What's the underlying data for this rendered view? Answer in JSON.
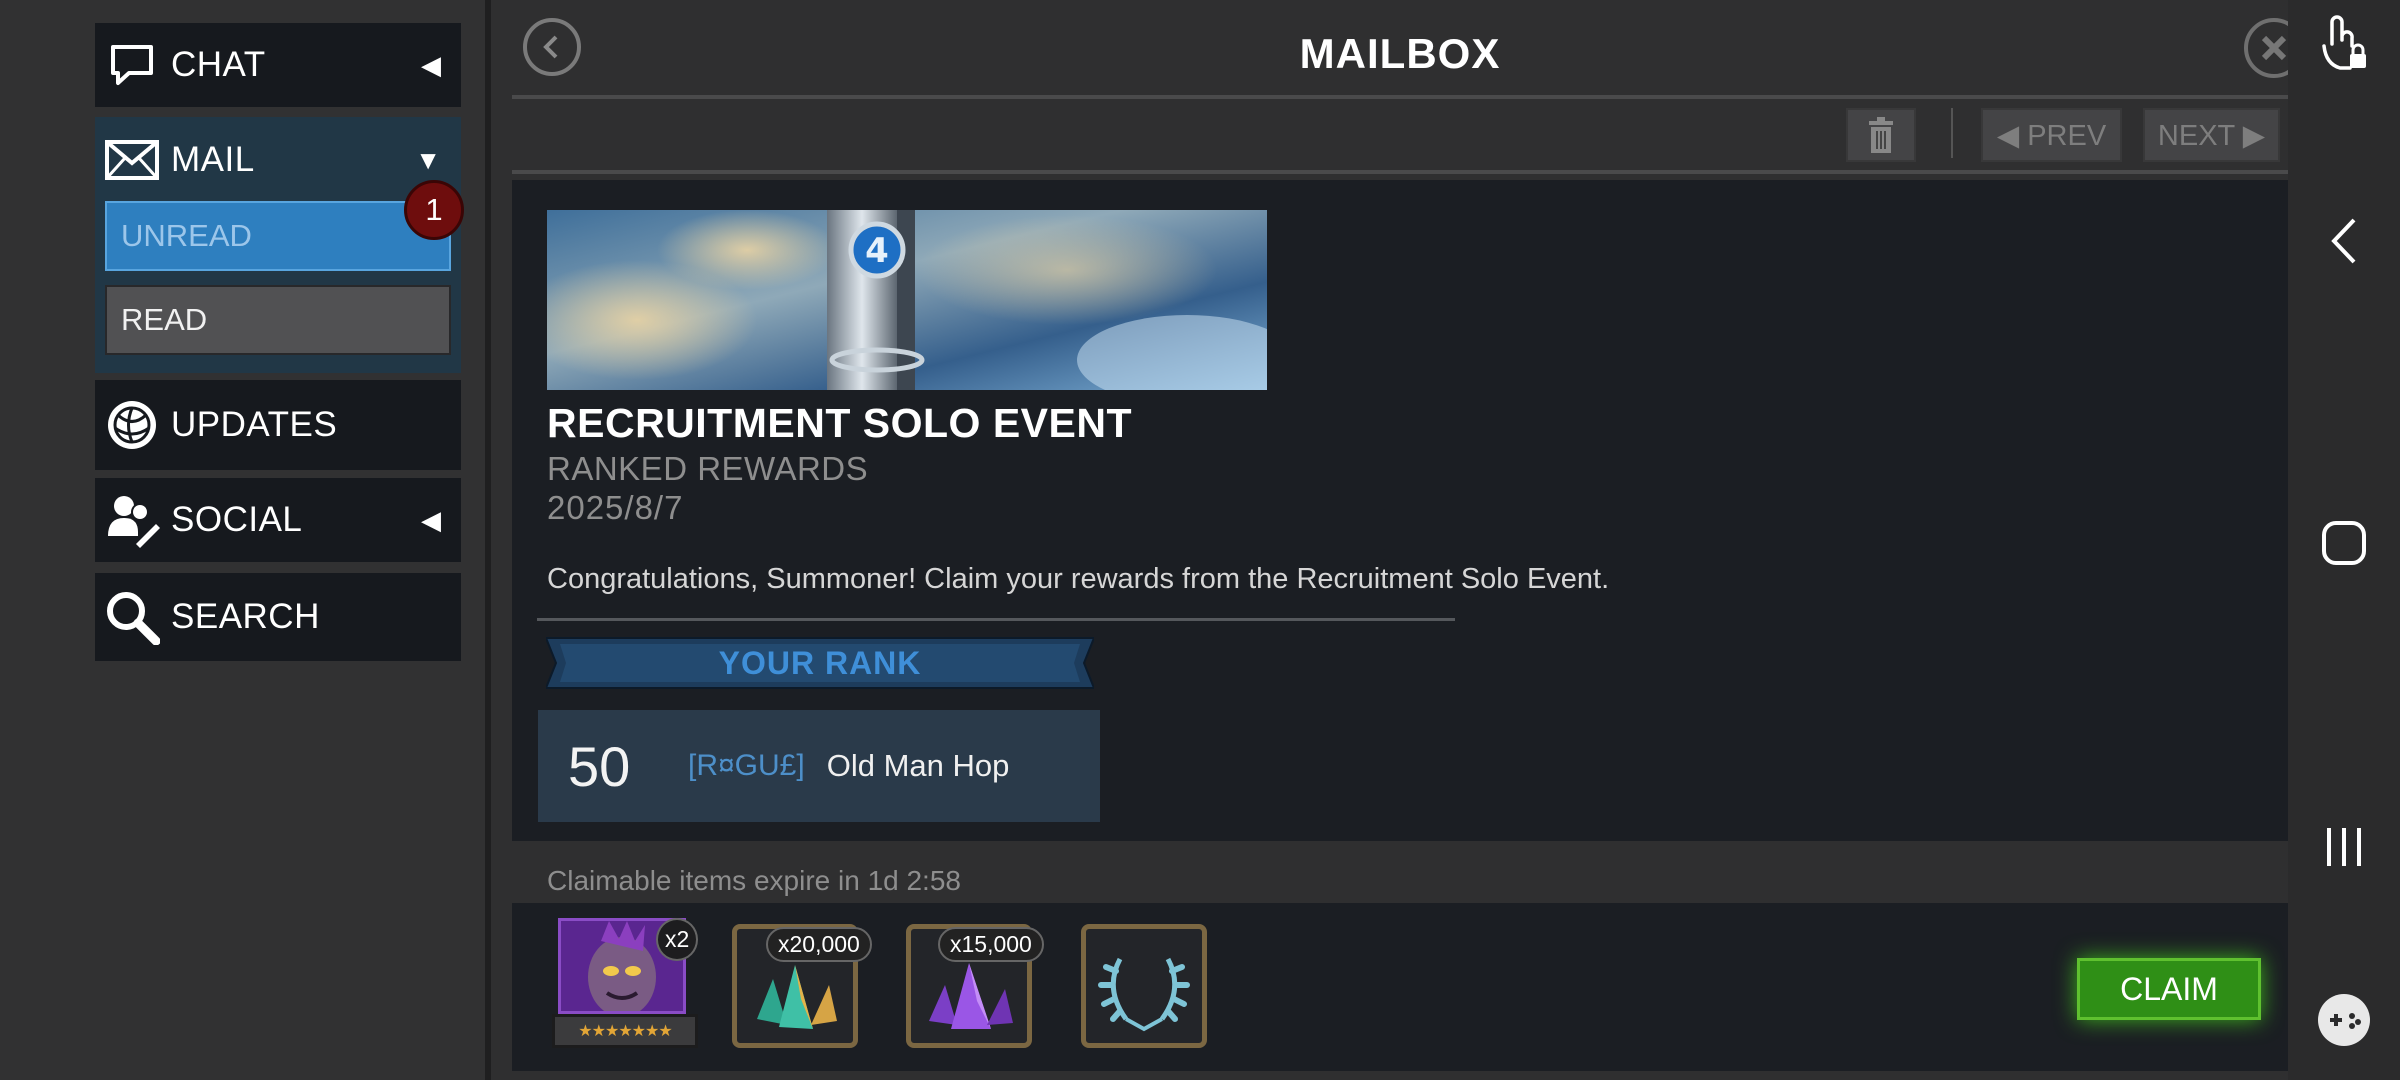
{
  "sidebar": {
    "chat_label": "CHAT",
    "mail_label": "MAIL",
    "unread_label": "UNREAD",
    "unread_count": "1",
    "read_label": "READ",
    "updates_label": "UPDATES",
    "social_label": "SOCIAL",
    "search_label": "SEARCH"
  },
  "header": {
    "title": "MAILBOX",
    "prev_label": "◀ PREV",
    "next_label": "NEXT ▶"
  },
  "mail": {
    "title": "RECRUITMENT SOLO EVENT",
    "subtitle": "RANKED REWARDS",
    "date": "2025/8/7",
    "message": "Congratulations, Summoner! Claim your rewards from the Recruitment Solo Event.",
    "rank_heading": "YOUR RANK",
    "rank_number": "50",
    "alliance_tag": "[R¤GU£]",
    "player_name": "Old Man Hop"
  },
  "rewards": {
    "expire_text": "Claimable items expire in 1d 2:58",
    "items": [
      {
        "icon": "champion-icon",
        "qty": "x2",
        "stars": "★★★★★★★"
      },
      {
        "icon": "teal-shard-icon",
        "qty": "x20,000"
      },
      {
        "icon": "purple-shard-icon",
        "qty": "x15,000"
      },
      {
        "icon": "laurel-wreath-icon",
        "qty": ""
      }
    ],
    "claim_label": "CLAIM"
  },
  "colors": {
    "accent_blue": "#2e7fbf",
    "claim_green": "#2f8f16",
    "badge_red": "#6e0d0d"
  }
}
